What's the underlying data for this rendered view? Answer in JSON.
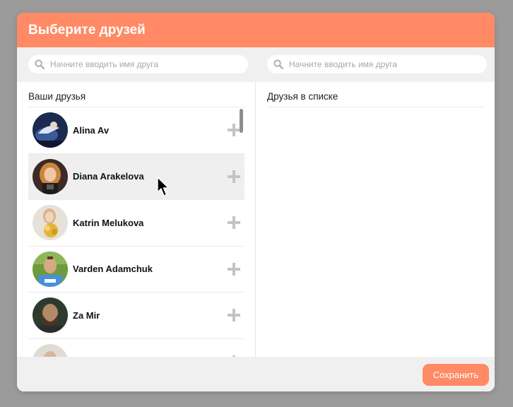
{
  "dialog": {
    "title": "Выберите друзей",
    "accent_color": "#ff8a65"
  },
  "search": {
    "left_placeholder": "Начните вводить имя друга",
    "right_placeholder": "Начните вводить имя друга",
    "icon": "search-icon"
  },
  "friends_pane": {
    "title": "Ваши друзья",
    "items": [
      {
        "name": "Alina Av",
        "avatar": "avatar-photo",
        "action_icon": "plus-icon"
      },
      {
        "name": "Diana Arakelova",
        "avatar": "avatar-photo",
        "action_icon": "plus-icon",
        "hovered": true
      },
      {
        "name": "Katrin Melukova",
        "avatar": "avatar-photo",
        "action_icon": "plus-icon"
      },
      {
        "name": "Varden Adamchuk",
        "avatar": "avatar-photo",
        "action_icon": "plus-icon"
      },
      {
        "name": "Za Mir",
        "avatar": "avatar-photo",
        "action_icon": "plus-icon"
      },
      {
        "name": "",
        "avatar": "avatar-photo",
        "action_icon": "plus-icon"
      }
    ]
  },
  "selected_pane": {
    "title": "Друзья в списке",
    "items": []
  },
  "footer": {
    "save_label": "Сохранить"
  }
}
